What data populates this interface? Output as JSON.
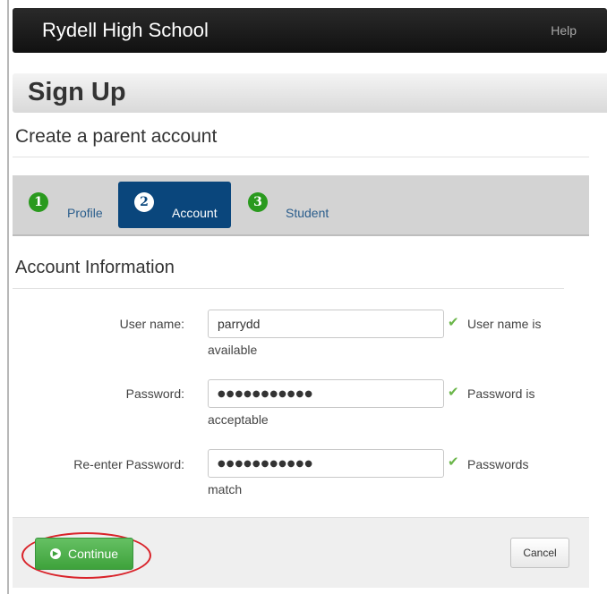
{
  "header": {
    "brand": "Rydell High School",
    "help_label": "Help"
  },
  "page": {
    "title": "Sign Up",
    "subtitle": "Create a parent account"
  },
  "steps": [
    {
      "number": "1",
      "label": "Profile",
      "active": false
    },
    {
      "number": "2",
      "label": "Account",
      "active": true
    },
    {
      "number": "3",
      "label": "Student",
      "active": false
    }
  ],
  "section": {
    "title": "Account Information"
  },
  "form": {
    "username": {
      "label": "User name:",
      "value": "parrydd",
      "message_line1": "User name is",
      "message_line2": "available"
    },
    "password": {
      "label": "Password:",
      "value": "●●●●●●●●●●●",
      "message_line1": "Password is",
      "message_line2": "acceptable"
    },
    "reenter": {
      "label": "Re-enter Password:",
      "value": "●●●●●●●●●●●",
      "message_line1": "Passwords",
      "message_line2": "match"
    }
  },
  "footer": {
    "continue_label": "Continue",
    "cancel_label": "Cancel"
  },
  "colors": {
    "topbar": "#1a1a1a",
    "active_step": "#0a467c",
    "step_circle": "#2a9a1e",
    "continue": "#4cae49",
    "highlight": "#d9232a",
    "check": "#6bb64a"
  }
}
